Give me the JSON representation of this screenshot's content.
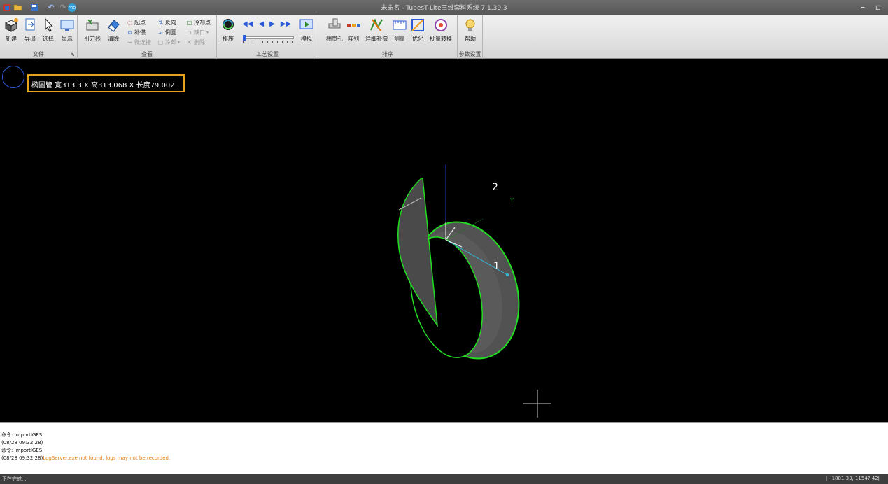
{
  "window": {
    "title": "未命名 - TubesT-Lite三维套料系统 7.1.39.3"
  },
  "ribbon": {
    "groups": {
      "file": "文件",
      "view": "查看",
      "process": "工艺设置",
      "sort": "排序",
      "params": "参数设置"
    },
    "file": {
      "new": "新建",
      "export": "导出",
      "select": "选择",
      "display": "显示"
    },
    "view": {
      "lead_line": "引刀线",
      "clear": "清除",
      "start_point": "起点",
      "compensation": "补偿",
      "micro_joint": "微连接",
      "reverse": "反向",
      "chamfer": "倒圆",
      "cooling": "冷却",
      "cooling_point": "冷却点",
      "notch": "缺口",
      "delete": "删除"
    },
    "process": {
      "sort": "排序",
      "simulate": "模拟"
    },
    "sort": {
      "pipe_hole": "相贯孔",
      "array": "阵列",
      "detail_comp": "详细补偿",
      "measure": "测量",
      "optimize": "优化",
      "batch_convert": "批量转换"
    },
    "params": {
      "help": "帮助"
    }
  },
  "viewport": {
    "info": "椭圆管 宽313.3 X 高313.068 X 长度79.002",
    "label_2": "2",
    "label_1": "1",
    "axis_y": "Y",
    "accent_color": "#e5a21c",
    "outline_color": "#22dd22"
  },
  "command_log": [
    {
      "text": "命令: ImportIGES",
      "warn": ""
    },
    {
      "text": "(08/28 09:32:28)",
      "warn": ""
    },
    {
      "text": "命令: ImportIGES",
      "warn": ""
    },
    {
      "text": "(08/28 09:32:28)",
      "warn": "LogServer.exe not found, logs may not be recorded."
    }
  ],
  "status": {
    "left": "正在完成...",
    "coords": "|1881.33, 1154?.42|"
  }
}
